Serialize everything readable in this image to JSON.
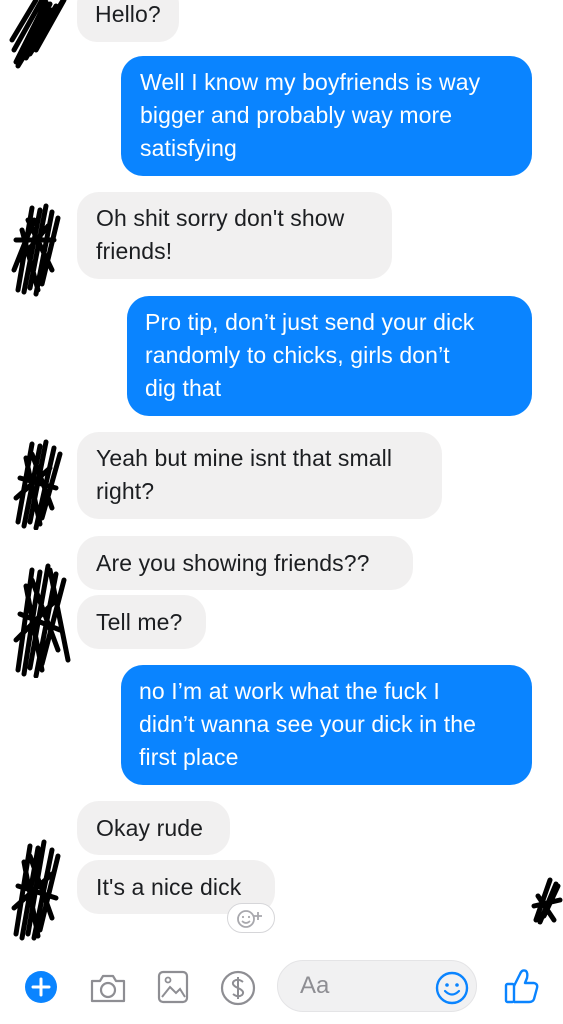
{
  "messages": [
    {
      "from": "them",
      "text": "Hello?"
    },
    {
      "from": "me",
      "text": "Well I know my boyfriends is way\nbigger and probably way more\nsatisfying"
    },
    {
      "from": "them",
      "text": "Oh shit sorry don't show\nfriends!"
    },
    {
      "from": "me",
      "text": "Pro tip, don’t just send your dick\nrandomly to chicks, girls don’t\ndig that"
    },
    {
      "from": "them",
      "text": "Yeah but mine isnt that small\nright?"
    },
    {
      "from": "them",
      "text": "Are you showing friends??"
    },
    {
      "from": "them",
      "text": "Tell me?"
    },
    {
      "from": "me",
      "text": "no I’m at work what the fuck I\ndidn’t wanna see your dick in the\nfirst place"
    },
    {
      "from": "them",
      "text": "Okay rude"
    },
    {
      "from": "them",
      "text": "It's a nice dick"
    }
  ],
  "composer": {
    "placeholder": "Aa",
    "icons": [
      "add-icon",
      "camera-icon",
      "gallery-icon",
      "payment-icon",
      "emoji-icon",
      "thumbs-up-icon"
    ]
  },
  "colors": {
    "outgoing": "#0a84ff",
    "incoming": "#f1f0f0",
    "accent": "#0a84ff"
  }
}
